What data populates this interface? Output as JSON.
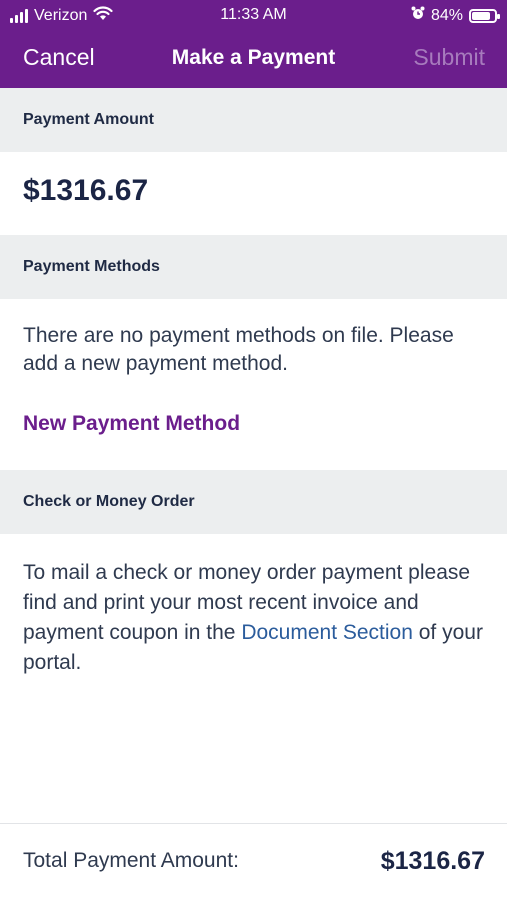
{
  "status_bar": {
    "carrier": "Verizon",
    "time": "11:33 AM",
    "battery": "84%",
    "battery_level": 0.84,
    "icons": [
      "signal-icon",
      "wifi-icon",
      "alarm-icon",
      "battery-icon"
    ]
  },
  "nav": {
    "cancel_label": "Cancel",
    "title": "Make a Payment",
    "submit_label": "Submit"
  },
  "payment_amount": {
    "header": "Payment Amount",
    "value": "$1316.67"
  },
  "payment_methods": {
    "header": "Payment Methods",
    "empty_text": "There are no payment methods on file. Please add a new payment method.",
    "new_method_label": "New Payment Method"
  },
  "check_money_order": {
    "header": "Check or Money Order",
    "text_before_link": "To mail a check or money order payment please find and print your most recent invoice and payment coupon in the ",
    "link_text": "Document Section",
    "text_after_link": " of your portal."
  },
  "footer": {
    "label": "Total Payment Amount:",
    "value": "$1316.67"
  },
  "colors": {
    "brand_purple": "#6b1e8c",
    "submit_disabled": "#a77bbd",
    "section_bg": "#eceeef",
    "link_blue": "#2b5c9c"
  }
}
